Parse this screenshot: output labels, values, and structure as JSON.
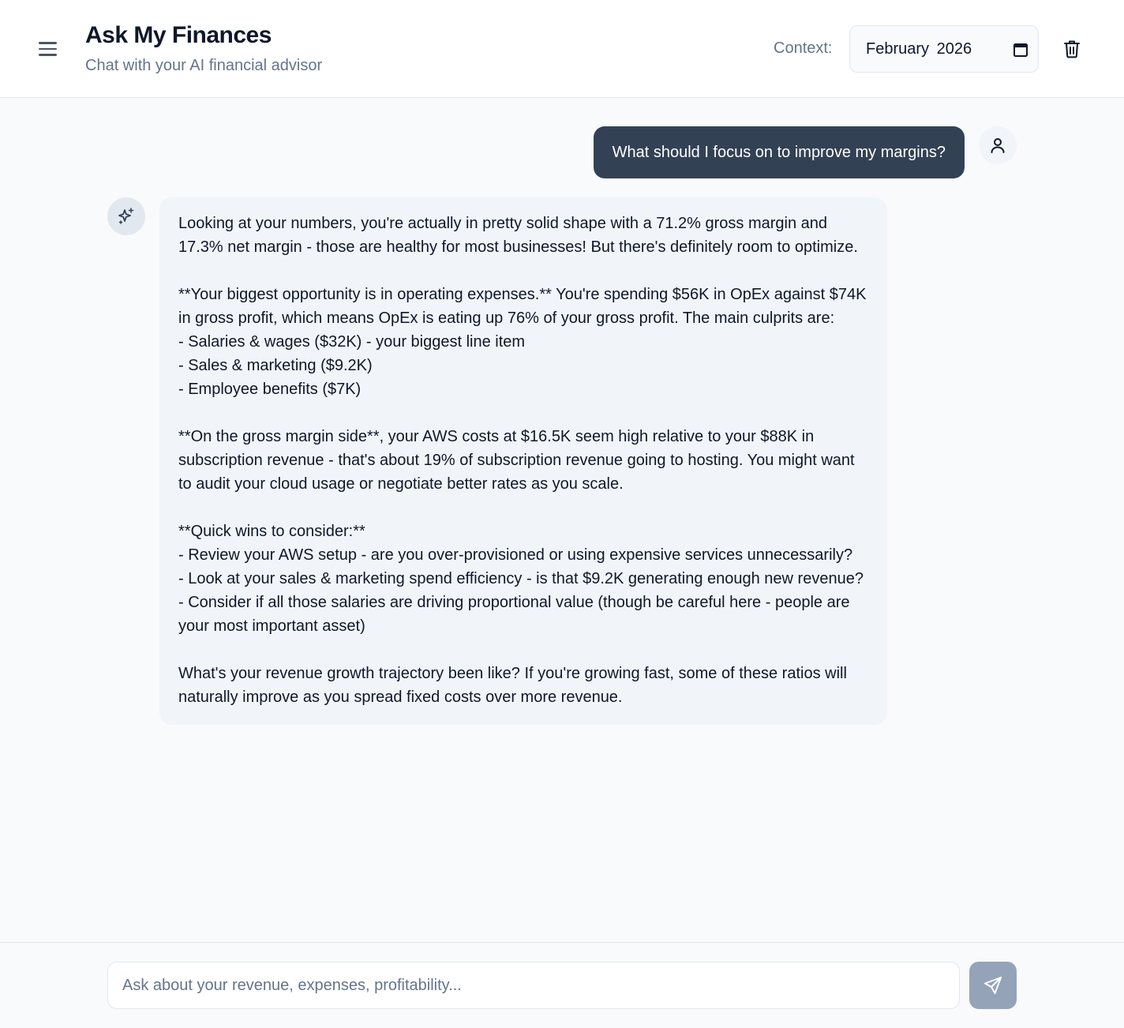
{
  "header": {
    "title": "Ask My Finances",
    "subtitle": "Chat with your AI financial advisor",
    "context_label": "Context:",
    "context_value": "February 2026",
    "icons": {
      "menu": "menu-icon",
      "calendar": "calendar-icon",
      "clear": "trash-icon"
    }
  },
  "conversation": {
    "user_message": "What should I focus on to improve my margins?",
    "assistant_message": "Looking at your numbers, you're actually in pretty solid shape with a 71.2% gross margin and 17.3% net margin - those are healthy for most businesses! But there's definitely room to optimize.\n\n**Your biggest opportunity is in operating expenses.** You're spending $56K in OpEx against $74K in gross profit, which means OpEx is eating up 76% of your gross profit. The main culprits are:\n- Salaries & wages ($32K) - your biggest line item\n- Sales & marketing ($9.2K)\n- Employee benefits ($7K)\n\n**On the gross margin side**, your AWS costs at $16.5K seem high relative to your $88K in subscription revenue - that's about 19% of subscription revenue going to hosting. You might want to audit your cloud usage or negotiate better rates as you scale.\n\n**Quick wins to consider:**\n- Review your AWS setup - are you over-provisioned or using expensive services unnecessarily?\n- Look at your sales & marketing spend efficiency - is that $9.2K generating enough new revenue?\n- Consider if all those salaries are driving proportional value (though be careful here - people are your most important asset)\n\nWhat's your revenue growth trajectory been like? If you're growing fast, some of these ratios will naturally improve as you spread fixed costs over more revenue.",
    "icons": {
      "user_avatar": "user-icon",
      "assistant_avatar": "sparkles-icon"
    }
  },
  "composer": {
    "placeholder": "Ask about your revenue, expenses, profitability...",
    "value": "",
    "send_icon": "send-icon"
  },
  "colors": {
    "user_bubble": "#334155",
    "assistant_bubble": "#f1f5f9",
    "send_button_disabled": "#94a3b8"
  }
}
